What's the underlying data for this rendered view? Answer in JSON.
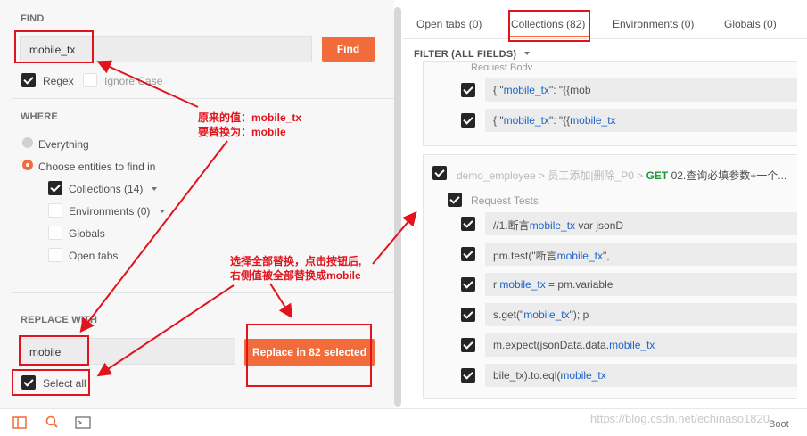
{
  "find": {
    "section_title": "FIND",
    "input_value": "mobile_tx",
    "button_label": "Find",
    "regex_label": "Regex",
    "ignore_case_label": "Ignore Case"
  },
  "where": {
    "section_title": "WHERE",
    "everything_label": "Everything",
    "choose_label": "Choose entities to find in",
    "collections_label": "Collections (14)",
    "environments_label": "Environments (0)",
    "globals_label": "Globals",
    "open_tabs_label": "Open tabs"
  },
  "replace": {
    "section_title": "REPLACE WITH",
    "input_value": "mobile",
    "button_label": "Replace in 82 selected",
    "select_all_label": "Select all"
  },
  "tabs": [
    {
      "label": "Open tabs (0)"
    },
    {
      "label": "Collections (82)"
    },
    {
      "label": "Environments (0)"
    },
    {
      "label": "Globals (0)"
    }
  ],
  "filter_label": "FILTER (ALL FIELDS)",
  "results": {
    "top_section_label": "Request Body",
    "top_rows": [
      {
        "pre": "{ \"",
        "hl": "mobile_tx",
        "post": "\": \"{{mob"
      },
      {
        "pre": "{ \"",
        "hl": "mobile_tx",
        "post": "\": \"{{",
        "hl2": "mobile_tx"
      }
    ],
    "crumb_path": "demo_employee > 员工添加|删除_P0 >",
    "crumb_method": "GET",
    "crumb_name": "02.查询必填参数+一个...",
    "section_label": "Request Tests",
    "rows": [
      {
        "pre": "//1.断言",
        "hl": "mobile_tx",
        "post": " var jsonD"
      },
      {
        "pre": "pm.test(\"断言",
        "hl": "mobile_tx",
        "post": "\","
      },
      {
        "pre": "r ",
        "hl": "mobile_tx",
        "post": " = pm.variable"
      },
      {
        "pre": "s.get(\"",
        "hl": "mobile_tx",
        "post": "\"); p"
      },
      {
        "pre": "m.expect(jsonData.data.",
        "hl": "mobile_tx",
        "post": ""
      },
      {
        "pre": "bile_tx).to.eql(",
        "hl": "mobile_tx",
        "post": ""
      }
    ]
  },
  "annotations": {
    "note1_line1": "原来的值：mobile_tx",
    "note1_line2": "要替换为：mobile",
    "note2_line1": "选择全部替换，点击按钮后,",
    "note2_line2": "右侧值被全部替换成mobile",
    "color": "#e1131c"
  },
  "watermark": "https://blog.csdn.net/echinaso1820",
  "bottom_right_label": "Boot",
  "icons": [
    "console-layout-icon",
    "search-icon",
    "terminal-icon",
    "dropdown-caret-icon",
    "checkbox-checked-icon"
  ],
  "colors": {
    "accent": "#f26b3a",
    "highlight": "#1e64c8",
    "method_get": "#1f9a3a"
  }
}
